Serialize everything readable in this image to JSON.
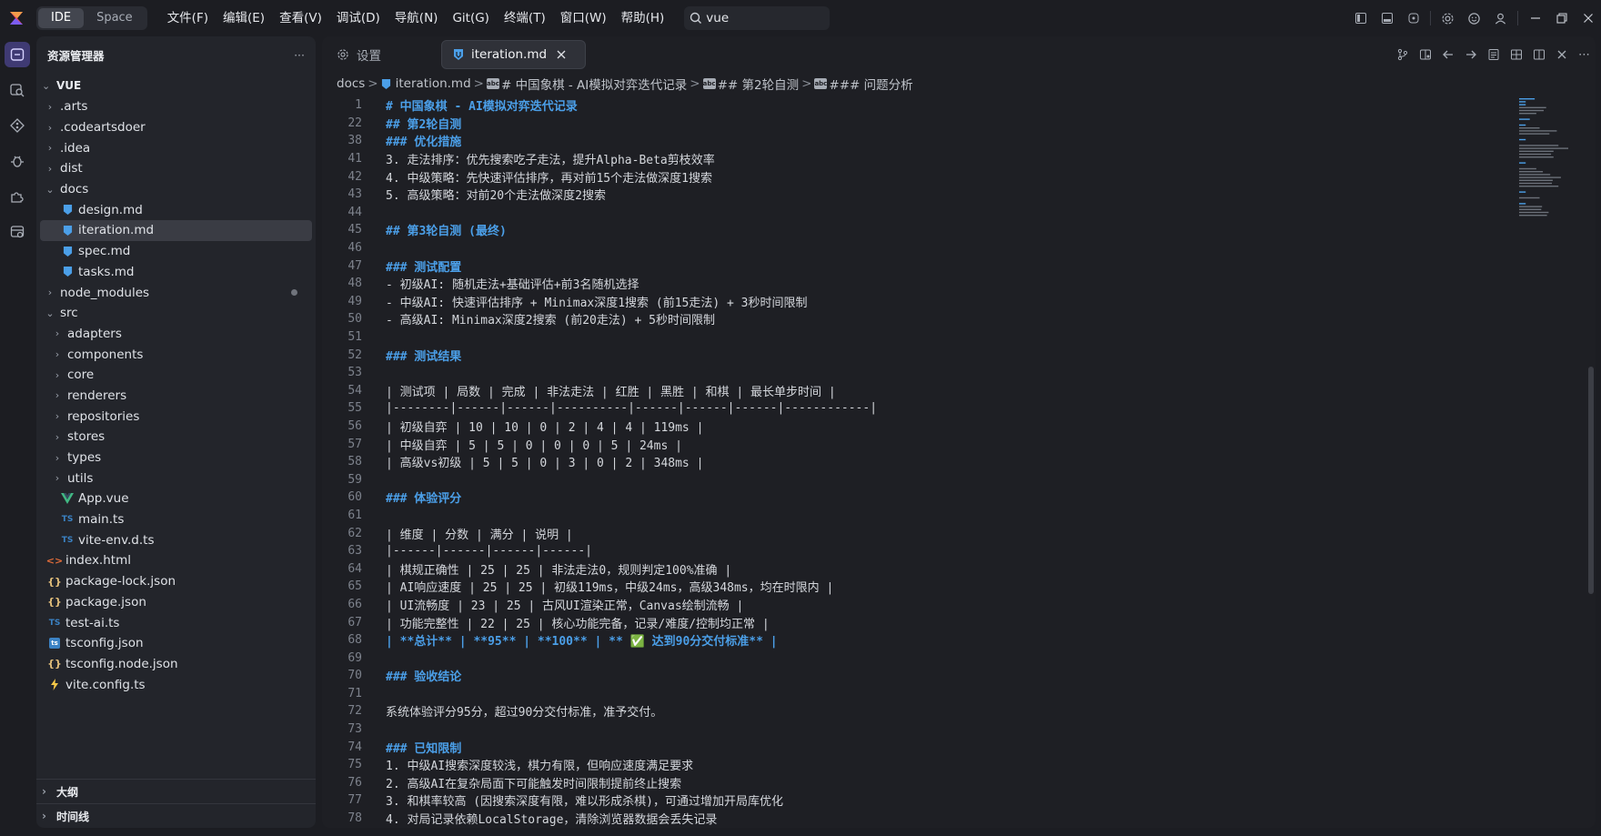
{
  "titlebar": {
    "mode_ide": "IDE",
    "mode_space": "Space",
    "menu": [
      "文件(F)",
      "编辑(E)",
      "查看(V)",
      "调试(D)",
      "导航(N)",
      "Git(G)",
      "终端(T)",
      "窗口(W)",
      "帮助(H)"
    ],
    "search_value": "vue"
  },
  "activity_bar": {
    "icons": [
      "explorer-icon",
      "search-icon",
      "source-control-icon",
      "debug-icon",
      "extensions-icon",
      "database-icon"
    ],
    "active_index": 0
  },
  "sidebar": {
    "title": "资源管理器",
    "more_label": "···",
    "root": "VUE",
    "tree": [
      {
        "label": ".arts",
        "type": "folder",
        "depth": 1,
        "expanded": false
      },
      {
        "label": ".codeartsdoer",
        "type": "folder",
        "depth": 1,
        "expanded": false
      },
      {
        "label": ".idea",
        "type": "folder",
        "depth": 1,
        "expanded": false
      },
      {
        "label": "dist",
        "type": "folder",
        "depth": 1,
        "expanded": false
      },
      {
        "label": "docs",
        "type": "folder",
        "depth": 1,
        "expanded": true
      },
      {
        "label": "design.md",
        "type": "md",
        "depth": 2
      },
      {
        "label": "iteration.md",
        "type": "md",
        "depth": 2,
        "selected": true
      },
      {
        "label": "spec.md",
        "type": "md",
        "depth": 2
      },
      {
        "label": "tasks.md",
        "type": "md",
        "depth": 2
      },
      {
        "label": "node_modules",
        "type": "folder",
        "depth": 1,
        "expanded": false,
        "dot": true
      },
      {
        "label": "src",
        "type": "folder",
        "depth": 1,
        "expanded": true
      },
      {
        "label": "adapters",
        "type": "folder",
        "depth": 2,
        "expanded": false
      },
      {
        "label": "components",
        "type": "folder",
        "depth": 2,
        "expanded": false
      },
      {
        "label": "core",
        "type": "folder",
        "depth": 2,
        "expanded": false
      },
      {
        "label": "renderers",
        "type": "folder",
        "depth": 2,
        "expanded": false
      },
      {
        "label": "repositories",
        "type": "folder",
        "depth": 2,
        "expanded": false
      },
      {
        "label": "stores",
        "type": "folder",
        "depth": 2,
        "expanded": false
      },
      {
        "label": "types",
        "type": "folder",
        "depth": 2,
        "expanded": false
      },
      {
        "label": "utils",
        "type": "folder",
        "depth": 2,
        "expanded": false
      },
      {
        "label": "App.vue",
        "type": "vue",
        "depth": 2
      },
      {
        "label": "main.ts",
        "type": "ts",
        "depth": 2
      },
      {
        "label": "vite-env.d.ts",
        "type": "ts",
        "depth": 2
      },
      {
        "label": "index.html",
        "type": "html",
        "depth": 1
      },
      {
        "label": "package-lock.json",
        "type": "json",
        "depth": 1
      },
      {
        "label": "package.json",
        "type": "json",
        "depth": 1
      },
      {
        "label": "test-ai.ts",
        "type": "ts",
        "depth": 1
      },
      {
        "label": "tsconfig.json",
        "type": "tsconfig",
        "depth": 1
      },
      {
        "label": "tsconfig.node.json",
        "type": "json",
        "depth": 1
      },
      {
        "label": "vite.config.ts",
        "type": "vite",
        "depth": 1
      }
    ],
    "sections": [
      "大纲",
      "时间线"
    ]
  },
  "editor": {
    "tabs": [
      {
        "label": "设置",
        "icon": "gear-icon",
        "active": false
      },
      {
        "label": "iteration.md",
        "icon": "markdown-icon",
        "active": true
      }
    ],
    "breadcrumb": [
      "docs",
      "iteration.md",
      "# 中国象棋 - AI模拟对弈迭代记录",
      "## 第2轮自测",
      "### 问题分析"
    ],
    "lines": [
      {
        "n": "1",
        "t": "# 中国象棋 - AI模拟对弈迭代记录",
        "k": "h1"
      },
      {
        "n": "22",
        "t": "## 第2轮自测",
        "k": "h2"
      },
      {
        "n": "38",
        "t": "### 优化措施",
        "k": "h3"
      },
      {
        "n": "41",
        "t": "3. 走法排序：优先搜索吃子走法，提升Alpha-Beta剪枝效率",
        "k": "list"
      },
      {
        "n": "42",
        "t": "4. 中级策略：先快速评估排序，再对前15个走法做深度1搜索",
        "k": "list"
      },
      {
        "n": "43",
        "t": "5. 高级策略：对前20个走法做深度2搜索",
        "k": "list"
      },
      {
        "n": "44",
        "t": "",
        "k": "text"
      },
      {
        "n": "45",
        "t": "## 第3轮自测 (最终)",
        "k": "h2"
      },
      {
        "n": "46",
        "t": "",
        "k": "text"
      },
      {
        "n": "47",
        "t": "### 测试配置",
        "k": "h3"
      },
      {
        "n": "48",
        "t": "- 初级AI: 随机走法+基础评估+前3名随机选择",
        "k": "list"
      },
      {
        "n": "49",
        "t": "- 中级AI: 快速评估排序 + Minimax深度1搜索 (前15走法) + 3秒时间限制",
        "k": "list"
      },
      {
        "n": "50",
        "t": "- 高级AI: Minimax深度2搜索 (前20走法) + 5秒时间限制",
        "k": "list"
      },
      {
        "n": "51",
        "t": "",
        "k": "text"
      },
      {
        "n": "52",
        "t": "### 测试结果",
        "k": "h3"
      },
      {
        "n": "53",
        "t": "",
        "k": "text"
      },
      {
        "n": "54",
        "t": "| 测试项 | 局数 | 完成 | 非法走法 | 红胜 | 黑胜 | 和棋 | 最长单步时间 |",
        "k": "text"
      },
      {
        "n": "55",
        "t": "|--------|------|------|----------|------|------|------|------------|",
        "k": "text"
      },
      {
        "n": "56",
        "t": "| 初级自弈 | 10 | 10 | 0 | 2 | 4 | 4 | 119ms |",
        "k": "text"
      },
      {
        "n": "57",
        "t": "| 中级自弈 | 5 | 5 | 0 | 0 | 0 | 5 | 24ms |",
        "k": "text"
      },
      {
        "n": "58",
        "t": "| 高级vs初级 | 5 | 5 | 0 | 3 | 0 | 2 | 348ms |",
        "k": "text"
      },
      {
        "n": "59",
        "t": "",
        "k": "text"
      },
      {
        "n": "60",
        "t": "### 体验评分",
        "k": "h3"
      },
      {
        "n": "61",
        "t": "",
        "k": "text"
      },
      {
        "n": "62",
        "t": "| 维度 | 分数 | 满分 | 说明 |",
        "k": "text"
      },
      {
        "n": "63",
        "t": "|------|------|------|------|",
        "k": "text"
      },
      {
        "n": "64",
        "t": "| 棋规正确性 | 25 | 25 | 非法走法0，规则判定100%准确 |",
        "k": "text"
      },
      {
        "n": "65",
        "t": "| AI响应速度 | 25 | 25 | 初级119ms，中级24ms，高级348ms，均在时限内 |",
        "k": "text"
      },
      {
        "n": "66",
        "t": "| UI流畅度 | 23 | 25 | 古风UI渲染正常，Canvas绘制流畅 |",
        "k": "text"
      },
      {
        "n": "67",
        "t": "| 功能完整性 | 22 | 25 | 核心功能完备，记录/难度/控制均正常 |",
        "k": "text"
      },
      {
        "n": "68",
        "t": "| **总计** | **95** | **100** | ** ✅ 达到90分交付标准** |",
        "k": "bold"
      },
      {
        "n": "69",
        "t": "",
        "k": "text"
      },
      {
        "n": "70",
        "t": "### 验收结论",
        "k": "h3"
      },
      {
        "n": "71",
        "t": "",
        "k": "text"
      },
      {
        "n": "72",
        "t": "系统体验评分95分，超过90分交付标准，准予交付。",
        "k": "text"
      },
      {
        "n": "73",
        "t": "",
        "k": "text"
      },
      {
        "n": "74",
        "t": "### 已知限制",
        "k": "h3"
      },
      {
        "n": "75",
        "t": "1. 中级AI搜索深度较浅，棋力有限，但响应速度满足要求",
        "k": "list"
      },
      {
        "n": "76",
        "t": "2. 高级AI在复杂局面下可能触发时间限制提前终止搜索",
        "k": "list"
      },
      {
        "n": "77",
        "t": "3. 和棋率较高 (因搜索深度有限，难以形成杀棋)，可通过增加开局库优化",
        "k": "list"
      },
      {
        "n": "78",
        "t": "4. 对局记录依赖LocalStorage，清除浏览器数据会丢失记录",
        "k": "list"
      }
    ]
  },
  "colors": {
    "accent": "#4b9fe8",
    "active_activity": "#3f3a73",
    "markdown_icon": "#4b9fe8",
    "vue_icon": "#41b883",
    "ts_icon": "#3b82c4",
    "json_icon": "#e5c07b",
    "html_icon": "#e06c3a"
  }
}
